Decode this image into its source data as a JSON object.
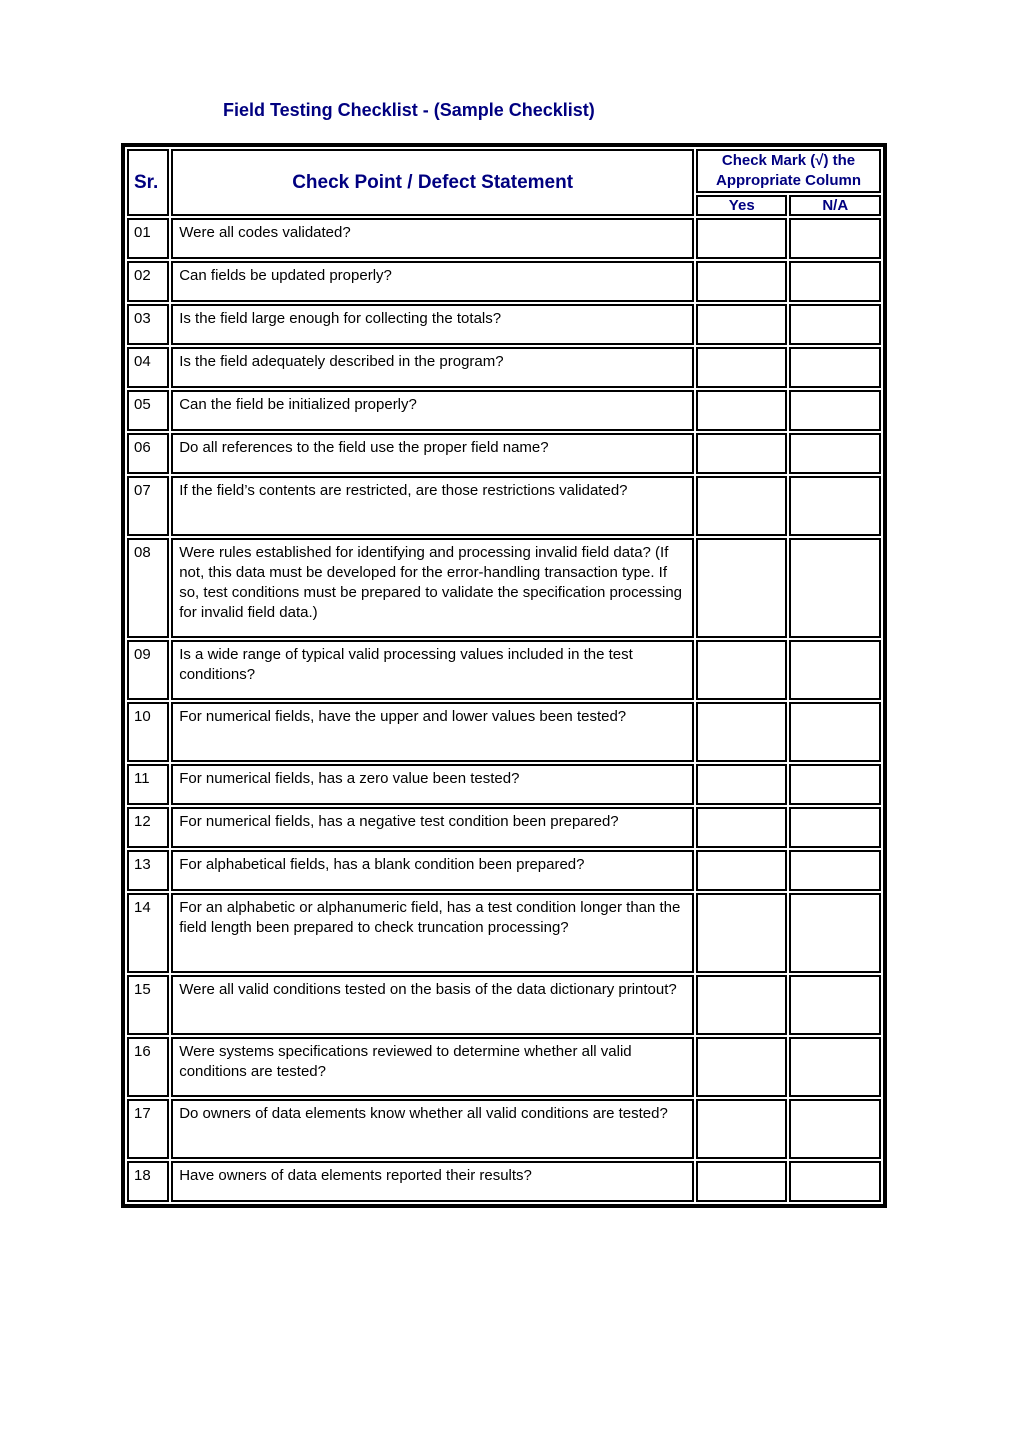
{
  "document": {
    "title": "Field Testing Checklist - (Sample Checklist)",
    "table": {
      "headers": {
        "sr": "Sr.",
        "statement": "Check Point / Defect Statement",
        "check_mark": "Check Mark (√) the Appropriate Column",
        "check_mark_line1": "Check Mark (√) the",
        "check_mark_line2": "Appropriate Column",
        "yes": "Yes",
        "na": "N/A"
      },
      "rows": [
        {
          "sr": "01",
          "statement": "Were all codes validated?",
          "yes": "",
          "na": ""
        },
        {
          "sr": "02",
          "statement": "Can fields be updated properly?",
          "yes": "",
          "na": ""
        },
        {
          "sr": "03",
          "statement": "Is the field large enough for collecting the totals?",
          "yes": "",
          "na": ""
        },
        {
          "sr": "04",
          "statement": "Is the field adequately described in the program?",
          "yes": "",
          "na": ""
        },
        {
          "sr": "05",
          "statement": "Can the field be initialized properly?",
          "yes": "",
          "na": ""
        },
        {
          "sr": "06",
          "statement": "Do all references to the field use the proper field name?",
          "yes": "",
          "na": ""
        },
        {
          "sr": "07",
          "statement": "If the field’s contents are restricted, are those restrictions validated?",
          "yes": "",
          "na": ""
        },
        {
          "sr": "08",
          "statement": "Were rules established for identifying and processing invalid field data? (If not, this data must be developed for the error-handling transaction type. If so, test conditions must be prepared to validate the specification processing for invalid field data.)",
          "yes": "",
          "na": ""
        },
        {
          "sr": "09",
          "statement": "Is a wide range of typical valid processing values included in the test conditions?",
          "yes": "",
          "na": ""
        },
        {
          "sr": "10",
          "statement": "For numerical fields, have the upper and lower values been tested?",
          "yes": "",
          "na": ""
        },
        {
          "sr": "11",
          "statement": "For numerical fields, has a zero value been tested?",
          "yes": "",
          "na": ""
        },
        {
          "sr": "12",
          "statement": "For numerical fields, has a negative test condition been prepared?",
          "yes": "",
          "na": ""
        },
        {
          "sr": "13",
          "statement": "For alphabetical fields, has a blank condition been prepared?",
          "yes": "",
          "na": ""
        },
        {
          "sr": "14",
          "statement": "For an alphabetic or alphanumeric field, has a test condition longer than the field length been prepared to check truncation processing?",
          "yes": "",
          "na": ""
        },
        {
          "sr": "15",
          "statement": "Were all valid conditions tested on the basis of the data dictionary printout?",
          "yes": "",
          "na": ""
        },
        {
          "sr": "16",
          "statement": "Were systems specifications reviewed to determine whether all valid conditions are tested?",
          "yes": "",
          "na": ""
        },
        {
          "sr": "17",
          "statement": "Do owners of data elements know whether all valid conditions are tested?",
          "yes": "",
          "na": ""
        },
        {
          "sr": "18",
          "statement": "Have owners of data elements reported their results?",
          "yes": "",
          "na": ""
        }
      ]
    }
  },
  "colors": {
    "heading": "#000080",
    "text": "#000000",
    "border": "#000000",
    "background": "#ffffff"
  }
}
